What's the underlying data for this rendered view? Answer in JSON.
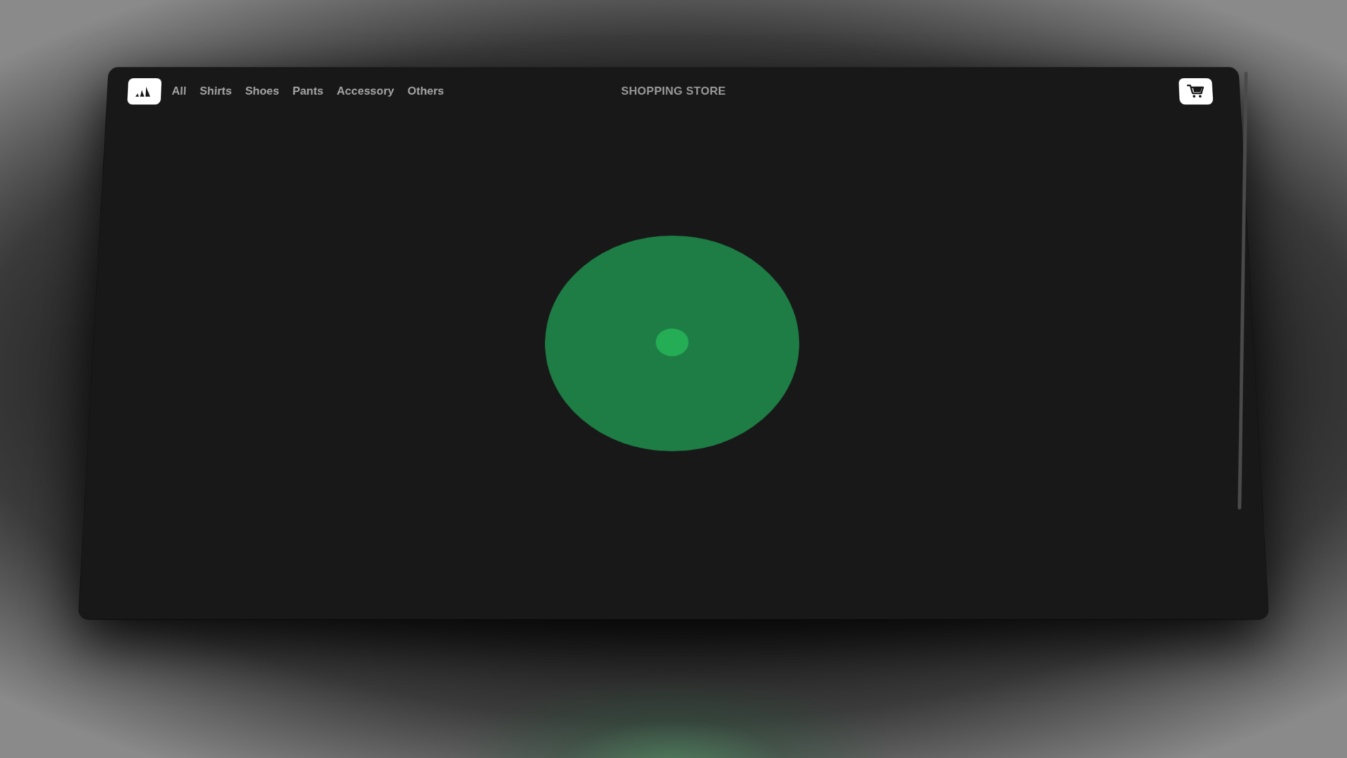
{
  "navbar": {
    "logo_icon": "adidas-logo-icon",
    "links": [
      "All",
      "Shirts",
      "Shoes",
      "Pants",
      "Accessory",
      "Others"
    ],
    "brand": "SHOPPING STORE",
    "cart_icon": "shopping-cart-icon"
  },
  "loader": {
    "icon": "loading-spinner",
    "outer_color": "#1e7d45",
    "inner_color": "#24ad55"
  },
  "colors": {
    "background": "#181818",
    "nav_text": "#a3a3a3",
    "button_bg": "#ffffff"
  }
}
